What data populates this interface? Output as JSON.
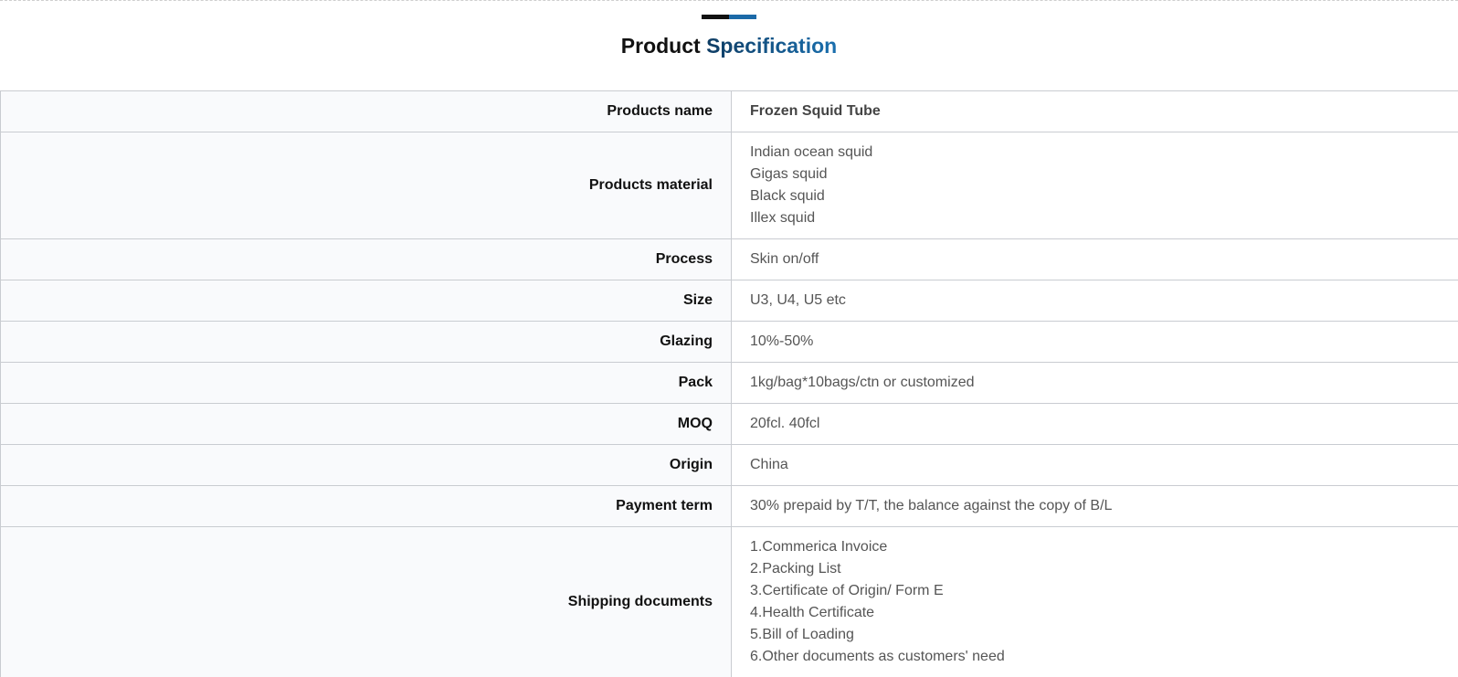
{
  "section": {
    "title_part1": "Product",
    "title_part2": "Specification"
  },
  "spec": {
    "products_name": {
      "label": "Products name",
      "value": "Frozen Squid Tube"
    },
    "products_material": {
      "label": "Products material",
      "values": [
        "Indian ocean squid",
        "Gigas squid",
        "Black squid",
        "Illex squid"
      ]
    },
    "process": {
      "label": "Process",
      "value": "Skin on/off"
    },
    "size": {
      "label": "Size",
      "value": "U3, U4, U5 etc"
    },
    "glazing": {
      "label": "Glazing",
      "value": "10%-50%"
    },
    "pack": {
      "label": "Pack",
      "value": "1kg/bag*10bags/ctn or customized"
    },
    "moq": {
      "label": "MOQ",
      "value": "20fcl. 40fcl"
    },
    "origin": {
      "label": "Origin",
      "value": "China"
    },
    "payment_term": {
      "label": "Payment term",
      "value": "30% prepaid by T/T, the balance against the copy of B/L"
    },
    "shipping_documents": {
      "label": "Shipping documents",
      "values": [
        "1.Commerica Invoice",
        "2.Packing List",
        "3.Certificate of Origin/ Form E",
        "4.Health Certificate",
        "5.Bill of Loading",
        "6.Other documents as customers' need"
      ]
    }
  },
  "colors": {
    "accent_blue": "#1c6aa8",
    "accent_dark": "#111111",
    "label_bg": "#f9fafc",
    "border": "#c9ccd1"
  }
}
